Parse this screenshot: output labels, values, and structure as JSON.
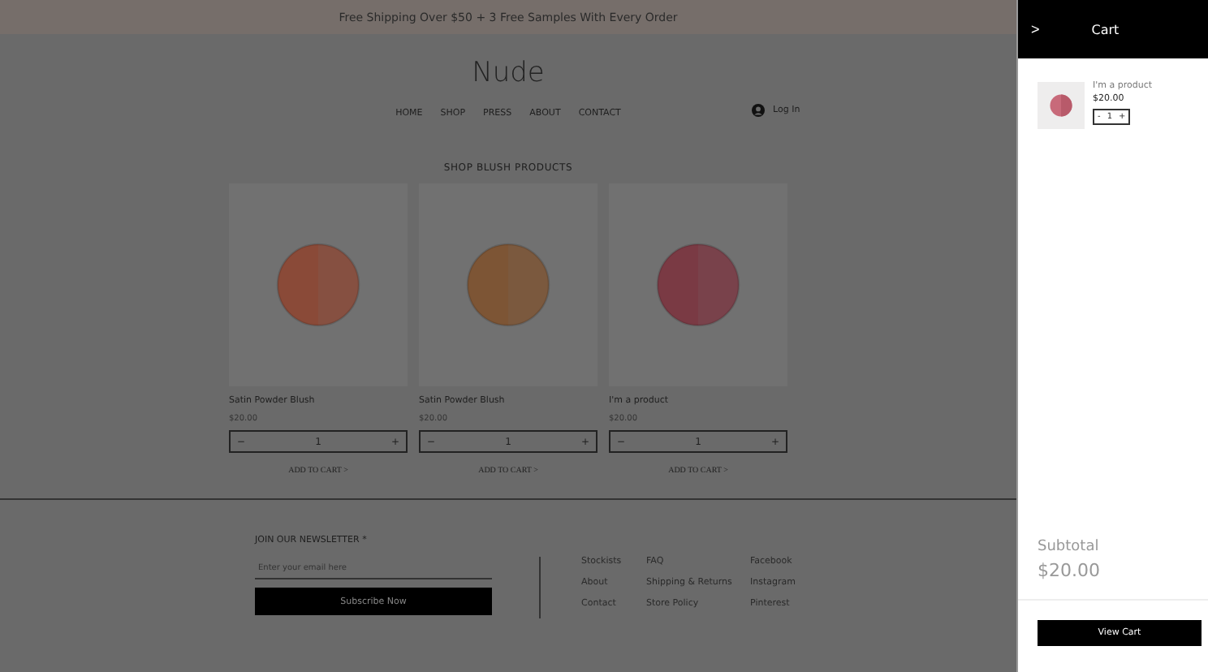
{
  "banner": {
    "text": "Free Shipping Over $50 + 3 Free Samples With Every Order"
  },
  "header": {
    "logo": "Nude",
    "nav": [
      "HOME",
      "SHOP",
      "PRESS",
      "ABOUT",
      "CONTACT"
    ],
    "login": "Log In"
  },
  "section_title": "SHOP BLUSH PRODUCTS",
  "products": [
    {
      "name": "Satin Powder Blush",
      "price": "$20.00",
      "quantity": "1",
      "minus": "−",
      "plus": "+",
      "add_to_cart": "ADD TO CART >"
    },
    {
      "name": "Satin Powder Blush",
      "price": "$20.00",
      "quantity": "1",
      "minus": "−",
      "plus": "+",
      "add_to_cart": "ADD TO CART >"
    },
    {
      "name": "I'm a product",
      "price": "$20.00",
      "quantity": "1",
      "minus": "−",
      "plus": "+",
      "add_to_cart": "ADD TO CART >"
    }
  ],
  "newsletter": {
    "title": "JOIN OUR NEWSLETTER *",
    "placeholder": "Enter your email here",
    "button": "Subscribe Now"
  },
  "footer_links": [
    [
      "Stockists",
      "About",
      "Contact"
    ],
    [
      "FAQ",
      "Shipping & Returns",
      "Store Policy"
    ],
    [
      "Facebook",
      "Instagram",
      "Pinterest"
    ]
  ],
  "cart": {
    "back": ">",
    "title": "Cart",
    "items": [
      {
        "name": "I'm a product",
        "price": "$20.00",
        "quantity": "1",
        "minus": "-",
        "plus": "+"
      }
    ],
    "subtotal_label": "Subtotal",
    "subtotal": "$20.00",
    "button": "View Cart"
  }
}
